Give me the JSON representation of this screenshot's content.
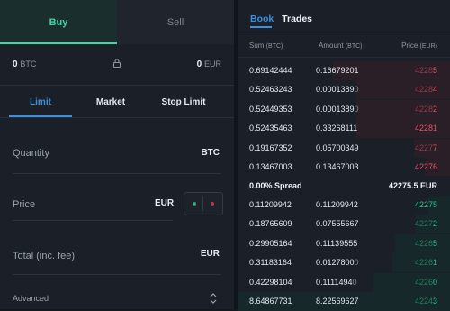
{
  "trade": {
    "buy_label": "Buy",
    "sell_label": "Sell",
    "balance_left": {
      "value": "0",
      "currency": "BTC"
    },
    "balance_right": {
      "value": "0",
      "currency": "EUR"
    },
    "order_types": [
      "Limit",
      "Market",
      "Stop Limit"
    ],
    "quantity": {
      "label": "Quantity",
      "unit": "BTC"
    },
    "price": {
      "label": "Price",
      "unit": "EUR"
    },
    "total": {
      "label": "Total (inc. fee)",
      "unit": "EUR"
    },
    "advanced_label": "Advanced"
  },
  "book": {
    "tabs": [
      "Book",
      "Trades"
    ],
    "headers": {
      "sum": "Sum",
      "sum_unit": "(BTC)",
      "amount": "Amount",
      "amount_unit": "(BTC)",
      "price": "Price",
      "price_unit": "(EUR)"
    },
    "asks": [
      {
        "sum": "0.69142444",
        "amount": "0.16679201",
        "amount_faded": "",
        "price": "4228",
        "price_tail": "5",
        "depth": 0.55
      },
      {
        "sum": "0.52463243",
        "amount": "0.0001389",
        "amount_faded": "0",
        "price": "4228",
        "price_tail": "4",
        "depth": 0.44
      },
      {
        "sum": "0.52449353",
        "amount": "0.0001389",
        "amount_faded": "0",
        "price": "4228",
        "price_tail": "2",
        "depth": 0.44
      },
      {
        "sum": "0.52435463",
        "amount": "0.33268111",
        "amount_faded": "",
        "price": "42281",
        "price_tail": "",
        "depth": 0.44
      },
      {
        "sum": "0.19167352",
        "amount": "0.05700349",
        "amount_faded": "",
        "price": "4227",
        "price_tail": "7",
        "depth": 0.17
      },
      {
        "sum": "0.13467003",
        "amount": "0.13467003",
        "amount_faded": "",
        "price": "42276",
        "price_tail": "",
        "depth": 0.12
      }
    ],
    "spread": {
      "label": "0.00% Spread",
      "value": "42275.5 EUR"
    },
    "bids": [
      {
        "sum": "0.11209942",
        "amount": "0.11209942",
        "amount_faded": "",
        "price": "42275",
        "price_tail": "",
        "depth": 0.1
      },
      {
        "sum": "0.18765609",
        "amount": "0.07555667",
        "amount_faded": "",
        "price": "4227",
        "price_tail": "2",
        "depth": 0.16
      },
      {
        "sum": "0.29905164",
        "amount": "0.11139555",
        "amount_faded": "",
        "price": "4226",
        "price_tail": "5",
        "depth": 0.26
      },
      {
        "sum": "0.31183164",
        "amount": "0.0127800",
        "amount_faded": "0",
        "price": "4226",
        "price_tail": "1",
        "depth": 0.27
      },
      {
        "sum": "0.42298104",
        "amount": "0.1111494",
        "amount_faded": "0",
        "price": "4226",
        "price_tail": "0",
        "depth": 0.36
      },
      {
        "sum": "8.64867731",
        "amount": "8.22569627",
        "amount_faded": "",
        "price": "4224",
        "price_tail": "3",
        "depth": 1.0
      }
    ]
  },
  "colors": {
    "buy": "#3fd6a4",
    "accent": "#3d8fe0",
    "ask": "#e0566b",
    "bid": "#2fc08a"
  }
}
